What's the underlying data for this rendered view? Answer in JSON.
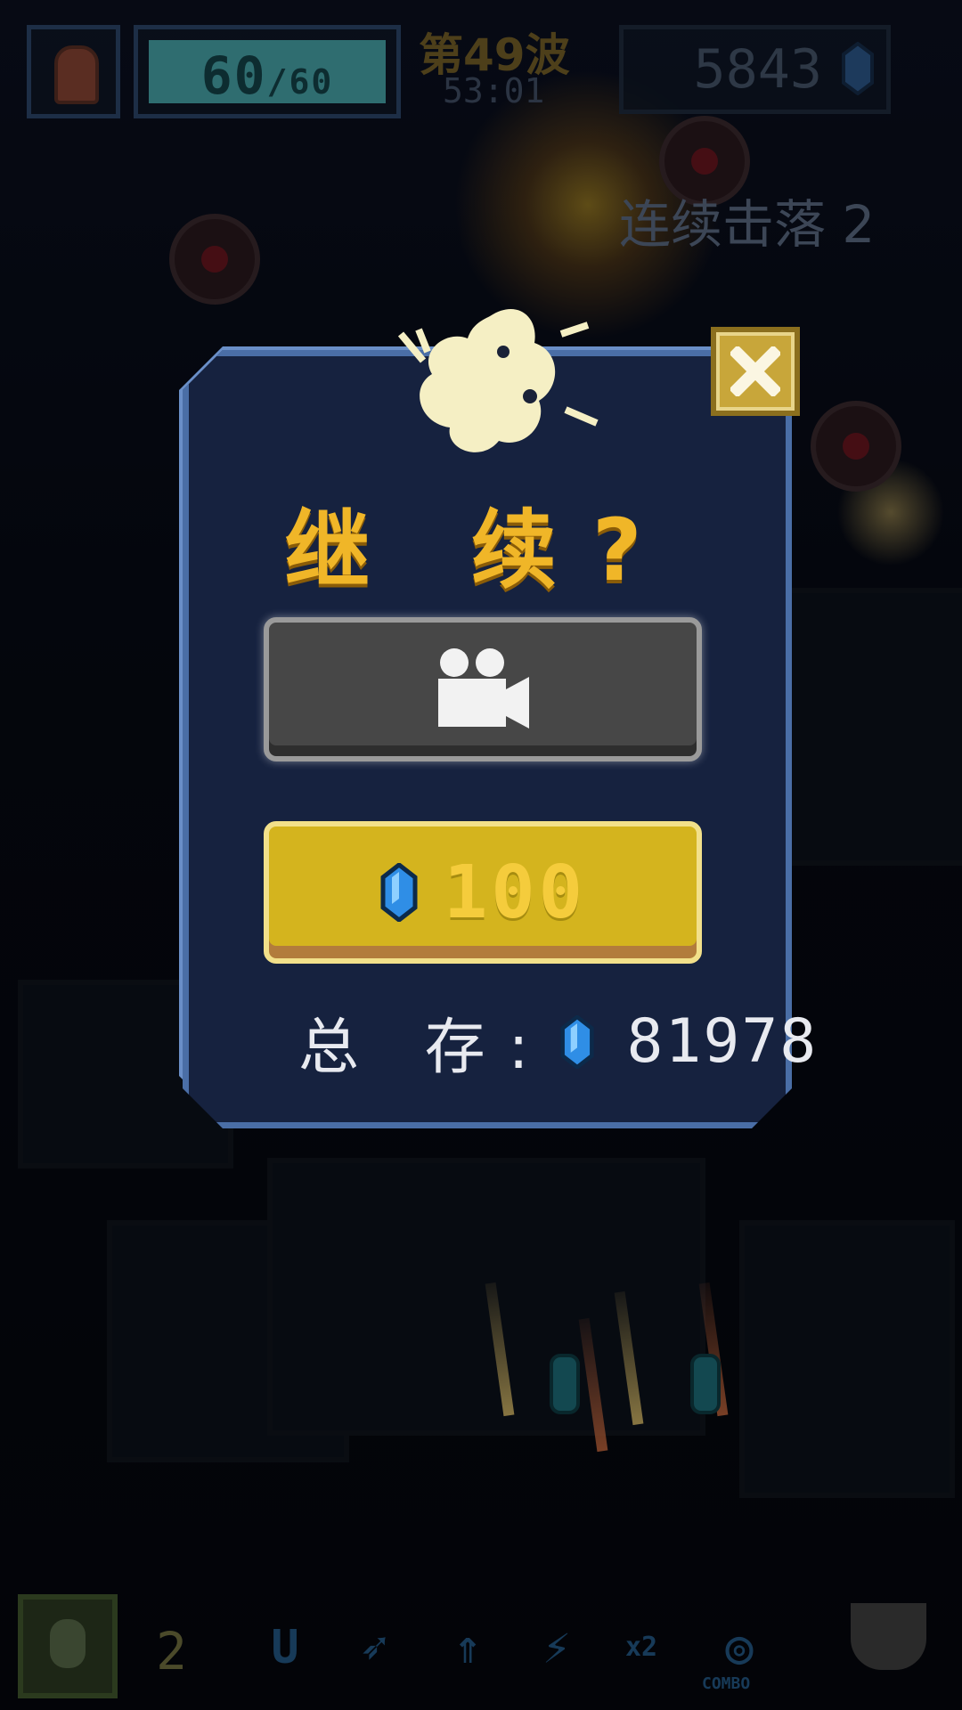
{
  "hud": {
    "hp_current": "60",
    "hp_max": "/60",
    "hp_fraction": 1.0,
    "wave": "第49波",
    "timer": "53:01",
    "score": "5843",
    "combo_text": "连续击落 2"
  },
  "dialog": {
    "title": "继 续?",
    "price": "100",
    "total_label": "总 存:",
    "total_amount": "81978"
  },
  "bottom_bar": {
    "bomb_count": "2",
    "combo_label": "COMBO",
    "multiplier": "x2"
  },
  "icons": {
    "close": "close-icon",
    "camera": "video-camera-icon",
    "gem": "blue-gem-icon"
  },
  "colors": {
    "dialog_bg": "#16223f",
    "dialog_border": "#4a6ea6",
    "title": "#f0b628",
    "gem_button": "#d4b41e",
    "watch_button": "#474747"
  }
}
